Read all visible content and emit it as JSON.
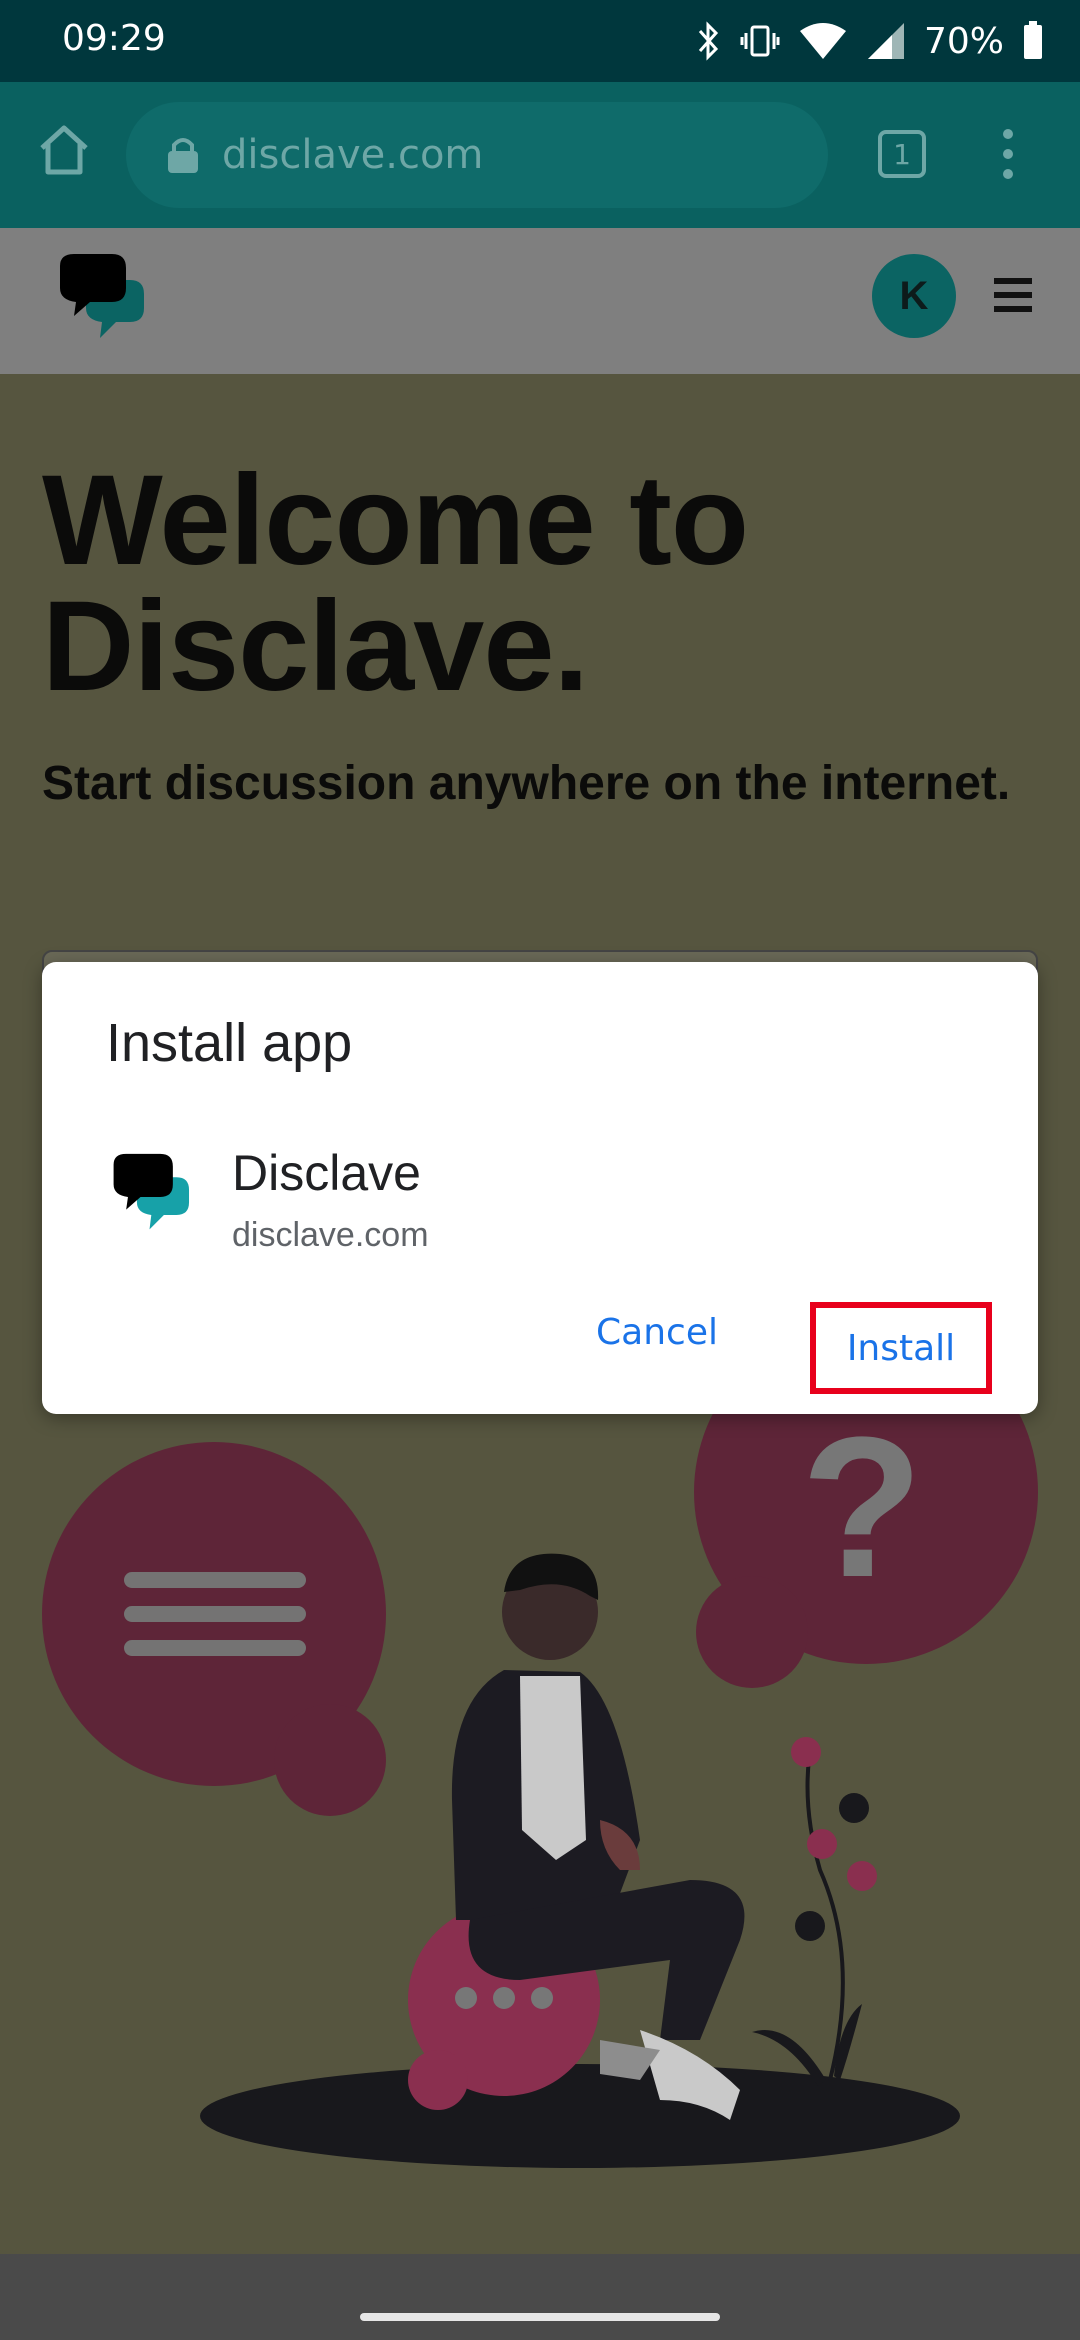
{
  "status_bar": {
    "time": "09:29",
    "battery": "70%",
    "icons": [
      "bluetooth-icon",
      "vibrate-icon",
      "wifi-icon",
      "signal-icon",
      "battery-icon"
    ]
  },
  "browser": {
    "url": "disclave.com",
    "tab_count": "1"
  },
  "site_header": {
    "avatar_initial": "K"
  },
  "hero": {
    "title": "Welcome to Disclave.",
    "subtitle": "Start discussion anywhere on the internet."
  },
  "dialog": {
    "title": "Install app",
    "app_name": "Disclave",
    "app_url": "disclave.com",
    "cancel_label": "Cancel",
    "install_label": "Install"
  },
  "colors": {
    "accent": "#1a73e8",
    "highlight": "#e8001c",
    "brand_teal": "#0b6463",
    "bubble": "#5e2538"
  }
}
